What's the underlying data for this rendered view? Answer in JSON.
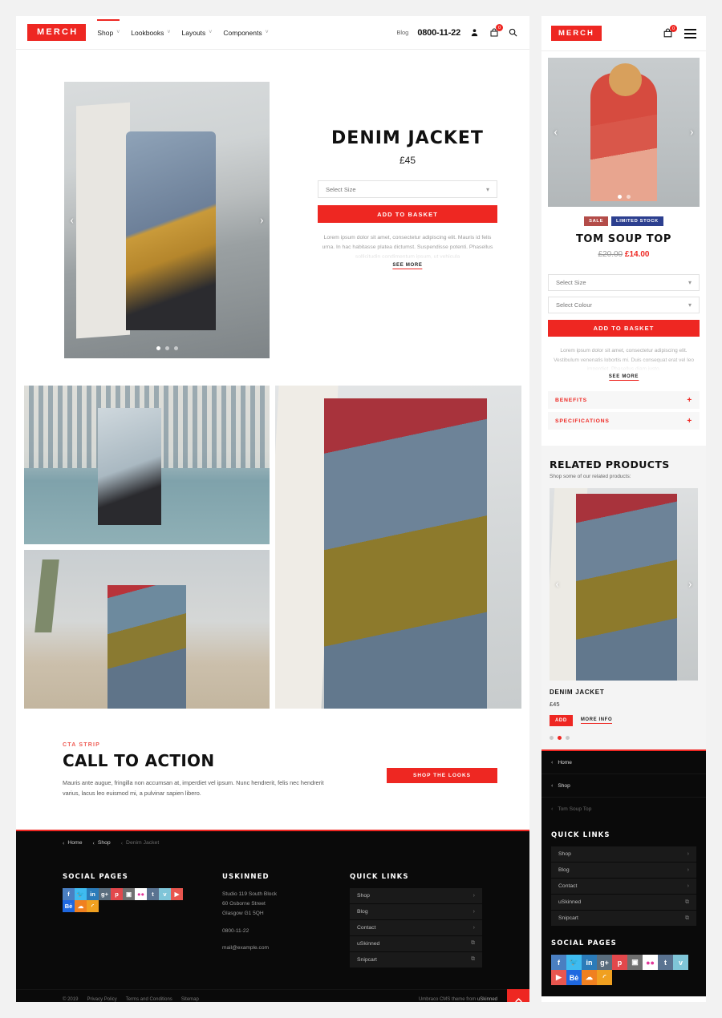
{
  "brand": {
    "name": "MERCH",
    "accent": "#ee2722"
  },
  "desktop": {
    "nav": [
      {
        "label": "Shop",
        "caret": "˅"
      },
      {
        "label": "Lookbooks",
        "caret": "˅"
      },
      {
        "label": "Layouts",
        "caret": "˅"
      },
      {
        "label": "Components",
        "caret": "˅"
      }
    ],
    "blog_label": "Blog",
    "phone": "0800-11-22",
    "account_icon": "user-icon",
    "cart_icon": "cart-icon",
    "cart_count": "0",
    "search_icon": "search-icon",
    "product": {
      "title": "DENIM JACKET",
      "price": "£45",
      "size_placeholder": "Select Size",
      "add_label": "ADD TO BASKET",
      "description": "Lorem ipsum dolor sit amet, consectetur adipiscing elit. Mauris id felis urna. In hac habitasse platea dictumst. Suspendisse potenti. Phasellus sollicitudin condimentum ipsum, ut vehicula",
      "see_more": "SEE MORE",
      "prev_arrow": "‹",
      "next_arrow": "›"
    },
    "cta": {
      "kicker": "CTA STRIP",
      "title": "CALL TO ACTION",
      "text": "Mauris ante augue, fringilla non accumsan at, imperdiet vel ipsum. Nunc hendrerit, felis nec hendrerit varius, lacus leo euismod mi, a pulvinar sapien libero.",
      "button": "SHOP THE LOOKS"
    },
    "footer": {
      "breadcrumbs": [
        {
          "label": "Home",
          "dim": false
        },
        {
          "label": "Shop",
          "dim": false
        },
        {
          "label": "Denim Jacket",
          "dim": true
        }
      ],
      "social_heading": "SOCIAL PAGES",
      "socials": [
        {
          "name": "facebook-icon",
          "glyph": "f",
          "color": "#4a7fc1"
        },
        {
          "name": "twitter-icon",
          "glyph": "🐦",
          "color": "#3fbbf0"
        },
        {
          "name": "linkedin-icon",
          "glyph": "in",
          "color": "#2b7bb9"
        },
        {
          "name": "googleplus-icon",
          "glyph": "g+",
          "color": "#5a6d7d"
        },
        {
          "name": "pinterest-icon",
          "glyph": "p",
          "color": "#e2484c"
        },
        {
          "name": "instagram-icon",
          "glyph": "▣",
          "color": "#6f6f6f"
        },
        {
          "name": "flickr-icon",
          "glyph": "●●",
          "color": "#ffffff"
        },
        {
          "name": "tumblr-icon",
          "glyph": "t",
          "color": "#5a7391"
        },
        {
          "name": "vimeo-icon",
          "glyph": "v",
          "color": "#7fc5d8"
        },
        {
          "name": "youtube-icon",
          "glyph": "▶",
          "color": "#e8564f"
        },
        {
          "name": "behance-icon",
          "glyph": "Bė",
          "color": "#1f68e0"
        },
        {
          "name": "soundcloud-icon",
          "glyph": "☁",
          "color": "#f08020"
        },
        {
          "name": "rss-icon",
          "glyph": "◜",
          "color": "#f0a020"
        }
      ],
      "company_heading": "USKINNED",
      "address_line1": "Studio 119 South Block",
      "address_line2": "60 Osborne Street",
      "address_line3": "Glasgow G1 5QH",
      "phone": "0800-11-22",
      "email": "mail@example.com",
      "quick_heading": "QUICK LINKS",
      "quick_links": [
        {
          "label": "Shop",
          "arrow": "›"
        },
        {
          "label": "Blog",
          "arrow": "›"
        },
        {
          "label": "Contact",
          "arrow": "›"
        },
        {
          "label": "uSkinned",
          "arrow": "⧉"
        },
        {
          "label": "Snipcart",
          "arrow": "⧉"
        }
      ],
      "copyright": "© 2019",
      "legal": [
        "Privacy Policy",
        "Terms and Conditions",
        "Sitemap"
      ],
      "credit_prefix": "Umbraco CMS theme from ",
      "credit_link": "uSkinned",
      "to_top_icon": "chevron-up-icon"
    }
  },
  "mobile": {
    "cart_icon": "cart-icon",
    "cart_count": "0",
    "menu_icon": "hamburger-icon",
    "product": {
      "badges": [
        {
          "label": "SALE",
          "type": "sale"
        },
        {
          "label": "LIMITED STOCK",
          "type": "stock"
        }
      ],
      "title": "TOM SOUP TOP",
      "old_price": "£20.00",
      "new_price": "£14.00",
      "size_placeholder": "Select Size",
      "colour_placeholder": "Select Colour",
      "add_label": "ADD TO BASKET",
      "description": "Lorem ipsum dolor sit amet, consectetur adipiscing elit. Vestibulum venenatis lobortis mi. Duis consequat erat vel leo imperdiet. Phasellus diam justo.",
      "see_more": "SEE MORE",
      "prev_arrow": "‹",
      "next_arrow": "›"
    },
    "accordions": [
      {
        "label": "BENEFITS",
        "toggle": "+"
      },
      {
        "label": "SPECIFICATIONS",
        "toggle": "+"
      }
    ],
    "related": {
      "heading": "RELATED PRODUCTS",
      "subheading": "Shop some of our related products:",
      "name": "DENIM JACKET",
      "price": "£45",
      "add_label": "ADD",
      "more_label": "MORE INFO",
      "prev_arrow": "‹",
      "next_arrow": "›"
    },
    "footer": {
      "breadcrumbs": [
        {
          "label": "Home",
          "dim": false
        },
        {
          "label": "Shop",
          "dim": false
        },
        {
          "label": "Tom Soup Top",
          "dim": true
        }
      ],
      "quick_heading": "QUICK LINKS",
      "quick_links": [
        {
          "label": "Shop",
          "arrow": "›"
        },
        {
          "label": "Blog",
          "arrow": "›"
        },
        {
          "label": "Contact",
          "arrow": "›"
        },
        {
          "label": "uSkinned",
          "arrow": "⧉"
        },
        {
          "label": "Snipcart",
          "arrow": "⧉"
        }
      ],
      "social_heading": "SOCIAL PAGES",
      "socials": [
        {
          "name": "facebook-icon",
          "glyph": "f",
          "color": "#4a7fc1"
        },
        {
          "name": "twitter-icon",
          "glyph": "🐦",
          "color": "#3fbbf0"
        },
        {
          "name": "linkedin-icon",
          "glyph": "in",
          "color": "#2b7bb9"
        },
        {
          "name": "googleplus-icon",
          "glyph": "g+",
          "color": "#5a6d7d"
        },
        {
          "name": "pinterest-icon",
          "glyph": "p",
          "color": "#e2484c"
        },
        {
          "name": "instagram-icon",
          "glyph": "▣",
          "color": "#6f6f6f"
        },
        {
          "name": "flickr-icon",
          "glyph": "●●",
          "color": "#ffffff"
        },
        {
          "name": "tumblr-icon",
          "glyph": "t",
          "color": "#5a7391"
        },
        {
          "name": "vimeo-icon",
          "glyph": "v",
          "color": "#7fc5d8"
        },
        {
          "name": "youtube-icon",
          "glyph": "▶",
          "color": "#e8564f"
        },
        {
          "name": "behance-icon",
          "glyph": "Bė",
          "color": "#1f68e0"
        },
        {
          "name": "soundcloud-icon",
          "glyph": "☁",
          "color": "#f08020"
        },
        {
          "name": "rss-icon",
          "glyph": "◜",
          "color": "#f0a020"
        }
      ]
    }
  }
}
